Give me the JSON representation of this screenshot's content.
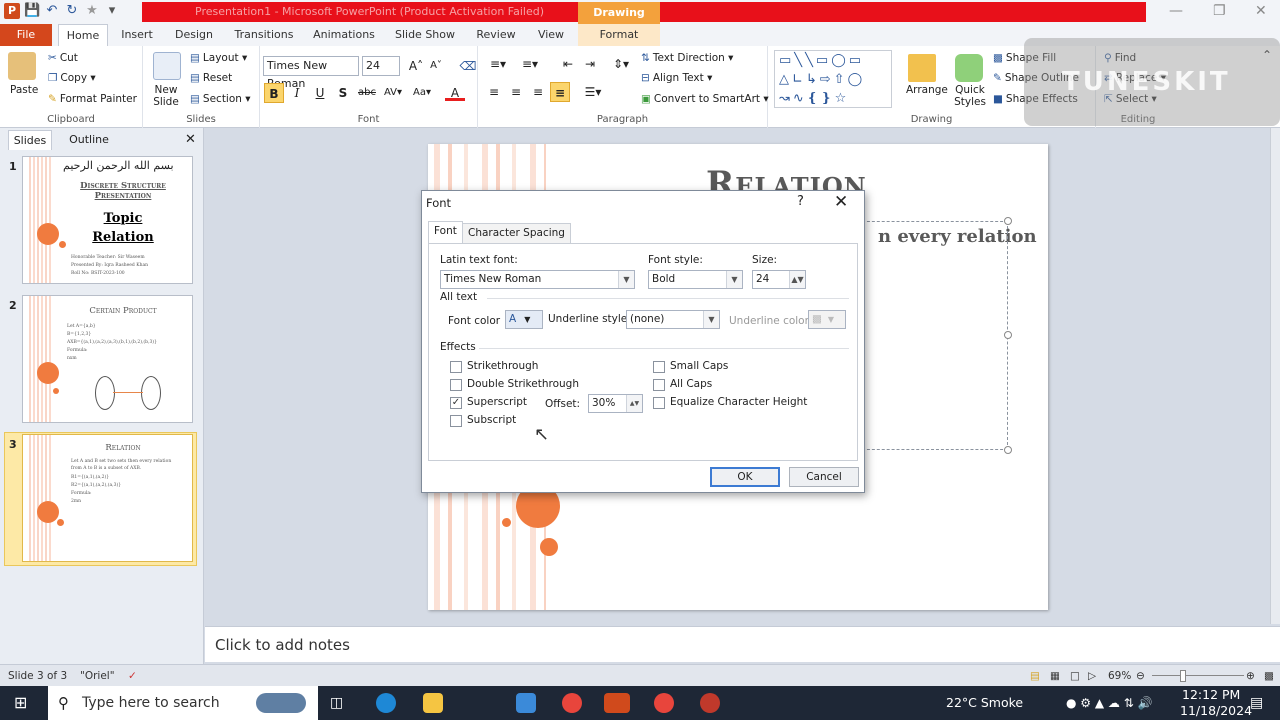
{
  "window": {
    "title": "Presentation1 - Microsoft PowerPoint (Product Activation Failed)",
    "context_tab": "Drawing Tools"
  },
  "tabs": [
    "File",
    "Home",
    "Insert",
    "Design",
    "Transitions",
    "Animations",
    "Slide Show",
    "Review",
    "View",
    "Format"
  ],
  "ribbon": {
    "clipboard": {
      "paste": "Paste",
      "cut": "Cut",
      "copy": "Copy",
      "format_painter": "Format Painter",
      "label": "Clipboard"
    },
    "slides": {
      "new_slide": "New Slide",
      "layout": "Layout",
      "reset": "Reset",
      "section": "Section",
      "label": "Slides"
    },
    "font": {
      "name": "Times New Roman",
      "size": "24",
      "label": "Font"
    },
    "paragraph": {
      "text_direction": "Text Direction",
      "align_text": "Align Text",
      "smartart": "Convert to SmartArt",
      "label": "Paragraph"
    },
    "drawing": {
      "arrange": "Arrange",
      "quick_styles": "Quick Styles",
      "shape_fill": "Shape Fill",
      "shape_outline": "Shape Outline",
      "shape_effects": "Shape Effects",
      "label": "Drawing"
    },
    "editing": {
      "find": "Find",
      "replace": "Replace",
      "select": "Select",
      "label": "Editing"
    }
  },
  "watermark": "TUNESKIT",
  "panel": {
    "tab_slides": "Slides",
    "tab_outline": "Outline",
    "thumbs": [
      {
        "num": "1",
        "arabic": "بسم الله الرحمن الرحيم",
        "title": "Discrete Structure Presentation",
        "topic": "Topic",
        "relation": "Relation",
        "lines": [
          "Honorable Teacher: Sir Waseem",
          "Presented By: Iqra Rasheed Khan",
          "Roll No: BSIT-2023-100"
        ]
      },
      {
        "num": "2",
        "title": "Certain Product",
        "lines": [
          "Let A={a,b}",
          "B={1,2,3}",
          "AXB={(a,1),(a,2),(a,3),(b,1),(b,2),(b,3)}",
          "Formula:",
          "nxm"
        ]
      },
      {
        "num": "3",
        "title": "Relation",
        "lines": [
          "Let A and B set two sets then every relation",
          "from A to B is a subset of AXB.",
          "R1={(a,1),(a,2)}",
          "R2={(a,1),(a,2),(a,3)}",
          "Formula:",
          "2mn"
        ]
      }
    ]
  },
  "slide": {
    "title": "Relation",
    "body_fragment": "n every relation"
  },
  "notes": {
    "placeholder": "Click to add notes"
  },
  "status": {
    "slide_info": "Slide 3 of 3",
    "theme": "\"Oriel\"",
    "zoom": "69%"
  },
  "dialog": {
    "title": "Font",
    "help": "?",
    "tabs": [
      "Font",
      "Character Spacing"
    ],
    "latin_font_label": "Latin text font:",
    "latin_font_value": "Times New Roman",
    "font_style_label": "Font style:",
    "font_style_value": "Bold",
    "size_label": "Size:",
    "size_value": "24",
    "all_text": "All text",
    "font_color_label": "Font color",
    "underline_style_label": "Underline style",
    "underline_style_value": "(none)",
    "underline_color_label": "Underline color",
    "effects": "Effects",
    "strikethrough": "Strikethrough",
    "double_strikethrough": "Double Strikethrough",
    "superscript": "Superscript",
    "offset_label": "Offset:",
    "offset_value": "30%",
    "subscript": "Subscript",
    "small_caps": "Small Caps",
    "all_caps": "All Caps",
    "equalize": "Equalize Character Height",
    "superscript_checked": true,
    "ok": "OK",
    "cancel": "Cancel"
  },
  "taskbar": {
    "search_placeholder": "Type here to search",
    "weather": "22°C  Smoke",
    "time": "12:12 PM",
    "date": "11/18/2024"
  }
}
